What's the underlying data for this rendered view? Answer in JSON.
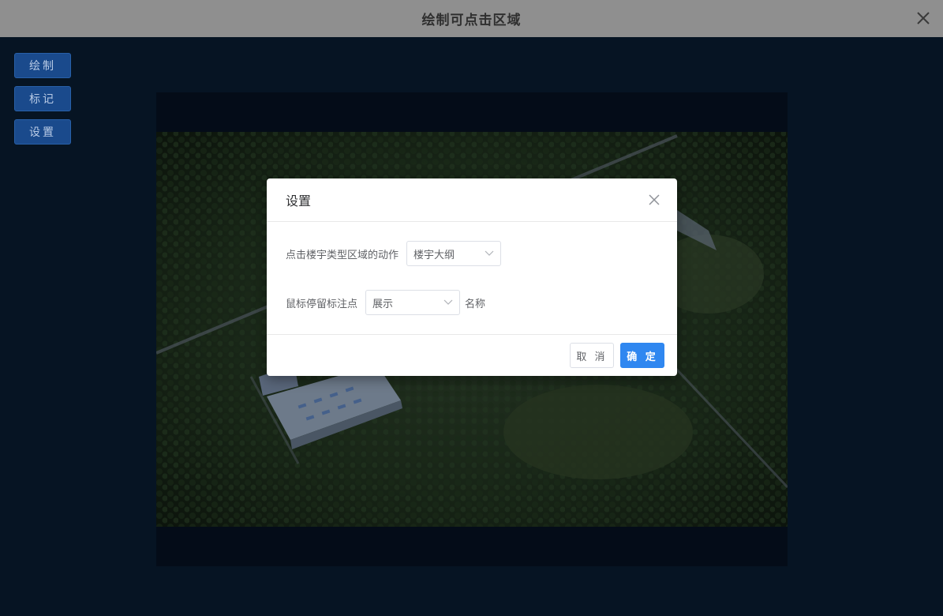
{
  "window": {
    "title": "绘制可点击区域",
    "close_icon": "close-icon"
  },
  "sidebar": {
    "items": [
      {
        "label": "绘制"
      },
      {
        "label": "标记"
      },
      {
        "label": "设置"
      }
    ]
  },
  "dialog": {
    "title": "设置",
    "close_icon": "close-icon",
    "click_action": {
      "label": "点击楼宇类型区域的动作",
      "value": "楼宇大纲"
    },
    "hover_marker": {
      "label": "鼠标停留标注点",
      "value": "展示",
      "suffix": "名称"
    },
    "cancel_label": "取 消",
    "confirm_label": "确 定"
  },
  "colors": {
    "background": "#061423",
    "titlebar": "#8f8f8f",
    "sidebar_button": "#1a4a8c",
    "primary": "#2f87f0"
  }
}
